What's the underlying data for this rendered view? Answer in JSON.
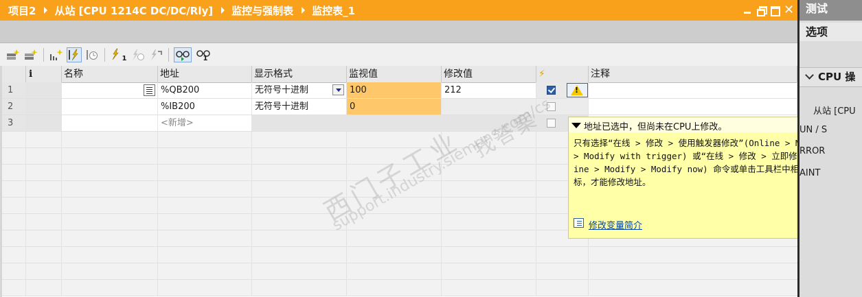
{
  "titlebar": {
    "breadcrumb": [
      "项目2",
      "从站 [CPU 1214C DC/DC/Rly]",
      "监控与强制表",
      "监控表_1"
    ],
    "close_glyph": "✕"
  },
  "colors": {
    "title_orange": "#f9a11b",
    "monitor_cell": "#fec86a",
    "tooltip_bg": "#ffffa8",
    "link": "#0044a8",
    "warning": "#f5c800"
  },
  "toolbar": {
    "icons": [
      "insert-row-icon",
      "add-row-icon",
      "extended-mode-icon",
      "modify-now-icon",
      "modify-with-trigger-icon",
      "enable-peripheral-outputs-icon",
      "modify-value-icon",
      "force-icon",
      "monitor-all-icon",
      "monitor-now-icon"
    ],
    "trigger_subscript": "1",
    "monitor_now_subscript": "1"
  },
  "table": {
    "columns": [
      "",
      "i",
      "名称",
      "地址",
      "显示格式",
      "监视值",
      "修改值",
      "⚡",
      "注释"
    ],
    "rows": [
      {
        "num": "1",
        "name": "",
        "address": "%QB200",
        "format": "无符号十进制",
        "monitor": "100",
        "modify": "212",
        "checked": true,
        "warning": true
      },
      {
        "num": "2",
        "name": "",
        "address": "%IB200",
        "format": "无符号十进制",
        "monitor": "0",
        "modify": "",
        "checked": false,
        "warning": false
      },
      {
        "num": "3",
        "name": "",
        "address": "<新增>",
        "format": "",
        "monitor": "",
        "modify": "",
        "checked": false,
        "warning": false
      }
    ]
  },
  "tooltip": {
    "title": "地址已选中，但尚未在CPU上修改。",
    "body": "只有选择“在线 > 修改 > 使用触发器修改”(Online > Modify > Modify with trigger) 或“在线 > 修改 > 立即修改”(Online > Modify > Modify now) 命令或单击工具栏中相应的图标，才能修改地址。",
    "link": "修改变量简介"
  },
  "right_panel": {
    "title": "测试",
    "options": "选项",
    "section": "CPU 操",
    "lines": [
      "从站 [CPU",
      "UN / S",
      "RROR",
      "AINT"
    ]
  },
  "watermark": {
    "line1": "找答案",
    "line2": "西门子工业",
    "line3": "support.industry.siemens.com/cs"
  }
}
